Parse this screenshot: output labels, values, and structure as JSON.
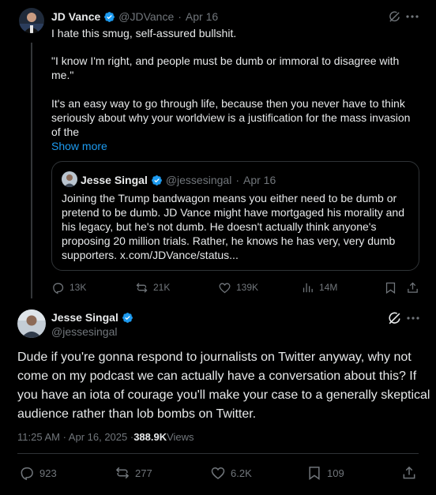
{
  "colors": {
    "accent": "#1d9bf0",
    "muted": "#71767b",
    "text": "#e7e9ea",
    "background": "#000000",
    "border": "#2f3336"
  },
  "first_tweet": {
    "author_name": "JD Vance",
    "handle": "@JDVance",
    "separator": "·",
    "date": "Apr 16",
    "lines": [
      "I hate this smug, self-assured bullshit.",
      "\"I know I'm right, and people must be dumb or immoral to disagree with",
      "me.\"",
      "It's an easy way to go through life, because then you never have to think",
      "seriously about why your worldview is a justification for the mass invasion",
      "of the"
    ],
    "show_more": "Show more",
    "quote": {
      "author_name": "Jesse Singal",
      "handle": "@jessesingal",
      "separator": "·",
      "date": "Apr 16",
      "lines": [
        "Joining the Trump bandwagon means you either need to be dumb or",
        "pretend to be dumb. JD Vance might have mortgaged his morality and",
        "his legacy, but he's not dumb. He doesn't actually think anyone's",
        "proposing 20 million trials. Rather, he knows he has very, very dumb",
        "supporters. x.com/JDVance/status..."
      ]
    },
    "stats": {
      "replies": "13K",
      "reposts": "21K",
      "likes": "139K",
      "views": "14M"
    }
  },
  "main_tweet": {
    "author_name": "Jesse Singal",
    "handle": "@jessesingal",
    "lines": [
      "Dude if you're gonna respond to journalists on Twitter anyway, why not",
      "come on my podcast we can actually have a conversation about this? If",
      "you have an iota of courage you'll make your case to a generally skeptical",
      "audience rather than lob bombs on Twitter."
    ],
    "timestamp": "11:25 AM · Apr 16, 2025 · ",
    "views_count": "388.9K",
    "views_label": " Views",
    "stats": {
      "replies": "923",
      "reposts": "277",
      "likes": "6.2K",
      "bookmarks": "109"
    }
  },
  "icons": [
    "grok-icon",
    "more-icon",
    "verified-badge-icon",
    "reply-icon",
    "repost-icon",
    "like-icon",
    "views-icon",
    "bookmark-icon",
    "share-icon"
  ]
}
